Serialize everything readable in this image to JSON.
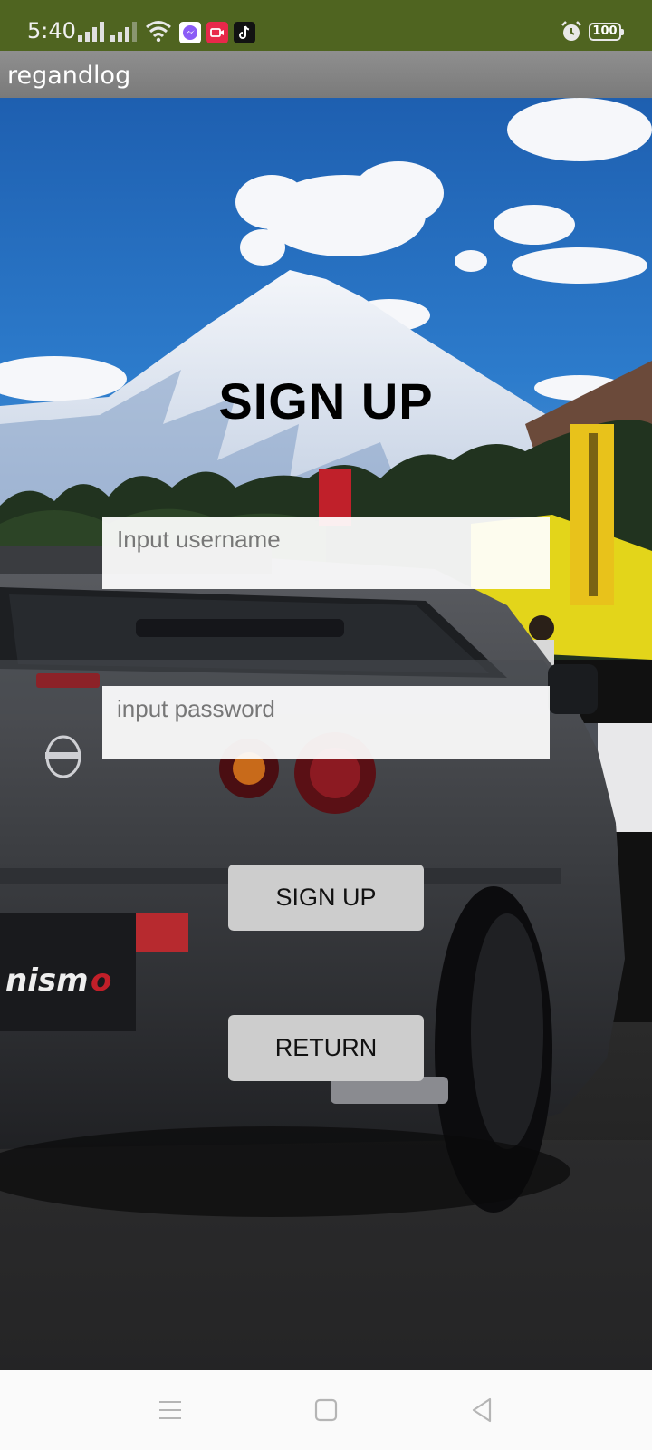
{
  "status_bar": {
    "time": "5:40",
    "battery_level": "100",
    "app_icons": [
      "messenger-icon",
      "video-call-icon",
      "tiktok-icon"
    ]
  },
  "app": {
    "title": "regandlog"
  },
  "form": {
    "heading": "SIGN UP",
    "username_placeholder": "Input username",
    "password_placeholder": "input password",
    "signup_label": "SIGN UP",
    "return_label": "RETURN"
  },
  "navigation": {
    "icons": [
      "menu-icon",
      "home-icon",
      "back-icon"
    ]
  },
  "colors": {
    "status_bar": "#4f6420",
    "action_bar": "#878787",
    "button_bg": "#cdcdcd",
    "field_bg": "#f4f4f4",
    "nav_bar": "#fafafa"
  }
}
